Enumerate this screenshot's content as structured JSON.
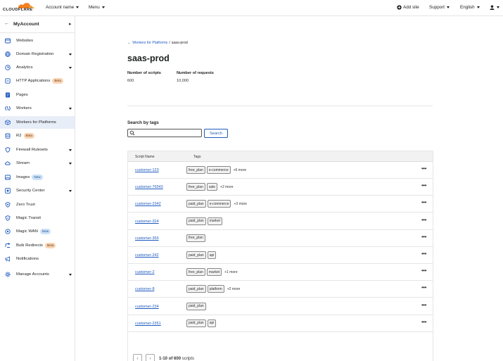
{
  "topbar": {
    "logo_text": "CLOUDFLARE",
    "account_name": "Account name",
    "menu": "Menu",
    "add_site": "Add site",
    "support": "Support",
    "language": "English"
  },
  "sidebar": {
    "title": "MyAccount",
    "items": [
      {
        "label": "Websites",
        "icon": "browser-icon",
        "caret": false,
        "badge": ""
      },
      {
        "label": "Domain Registration",
        "icon": "globe-icon",
        "caret": true,
        "badge": ""
      },
      {
        "label": "Analytics",
        "icon": "clock-icon",
        "caret": true,
        "badge": ""
      },
      {
        "label": "HTTP Applications",
        "icon": "app-icon",
        "caret": false,
        "badge": "Beta"
      },
      {
        "label": "Pages",
        "icon": "pages-icon",
        "caret": false,
        "badge": ""
      },
      {
        "label": "Workers",
        "icon": "workers-icon",
        "caret": true,
        "badge": ""
      },
      {
        "label": "Workers for Platforms",
        "icon": "box-icon",
        "caret": false,
        "badge": "",
        "active": true
      },
      {
        "label": "R2",
        "icon": "database-icon",
        "caret": false,
        "badge": "Beta"
      },
      {
        "label": "Firewall Rulesets",
        "icon": "shield-icon",
        "caret": true,
        "badge": ""
      },
      {
        "label": "Stream",
        "icon": "cloud-icon",
        "caret": true,
        "badge": ""
      },
      {
        "label": "Images",
        "icon": "image-icon",
        "caret": false,
        "badge": "New"
      },
      {
        "label": "Security Center",
        "icon": "security-center-icon",
        "caret": true,
        "badge": ""
      },
      {
        "label": "Zero Trust",
        "icon": "zero-trust-icon",
        "caret": false,
        "badge": ""
      },
      {
        "label": "Magic Transit",
        "icon": "magic-transit-icon",
        "caret": false,
        "badge": ""
      },
      {
        "label": "Magic WAN",
        "icon": "magic-wan-icon",
        "caret": false,
        "badge": "New"
      },
      {
        "label": "Bulk Redirects",
        "icon": "redirect-icon",
        "caret": false,
        "badge": "Beta"
      },
      {
        "label": "Notifications",
        "icon": "megaphone-icon",
        "caret": false,
        "badge": ""
      },
      {
        "label": "Manage Accounts",
        "icon": "gear-icon",
        "caret": true,
        "badge": ""
      }
    ]
  },
  "breadcrumb": {
    "parent": "Workers for Platforms",
    "separator": "/",
    "current": "saas-prod"
  },
  "page_title": "saas-prod",
  "stats": [
    {
      "label": "Number of scripts",
      "value": "600"
    },
    {
      "label": "Number of requests",
      "value": "10,000"
    }
  ],
  "search": {
    "label": "Search by tags",
    "placeholder": "",
    "value": "",
    "button": "Search"
  },
  "table": {
    "headers": [
      "Script Name",
      "Tags"
    ],
    "rows": [
      {
        "name": "customer-123",
        "tags": [
          "free_plan",
          "e-commerce"
        ],
        "more": "+6 more"
      },
      {
        "name": "customer-76543",
        "tags": [
          "free_plan",
          "sale"
        ],
        "more": "+2 more"
      },
      {
        "name": "customer-2342",
        "tags": [
          "paid_plan",
          "e-commerce"
        ],
        "more": "+3 more"
      },
      {
        "name": "customer-324",
        "tags": [
          "paid_plan",
          "market"
        ],
        "more": ""
      },
      {
        "name": "customer-355",
        "tags": [
          "free_plan"
        ],
        "more": ""
      },
      {
        "name": "customer-242",
        "tags": [
          "paid_plan",
          "api"
        ],
        "more": ""
      },
      {
        "name": "customer-2",
        "tags": [
          "free_plan",
          "market"
        ],
        "more": "+1 more"
      },
      {
        "name": "customer-8",
        "tags": [
          "paid_plan",
          "platform"
        ],
        "more": "+2 more"
      },
      {
        "name": "customer-234",
        "tags": [
          "paid_plan"
        ],
        "more": ""
      },
      {
        "name": "customer-2351",
        "tags": [
          "paid_plan",
          "api"
        ],
        "more": ""
      }
    ],
    "row_menu": "•••"
  },
  "pagination": {
    "prev": "‹",
    "next": "›",
    "range": "1-10",
    "of": "of",
    "total": "600",
    "unit": "scripts"
  },
  "colors": {
    "accent": "#f38020",
    "link": "#1f5bbf",
    "active_bg": "#e8eef8"
  }
}
